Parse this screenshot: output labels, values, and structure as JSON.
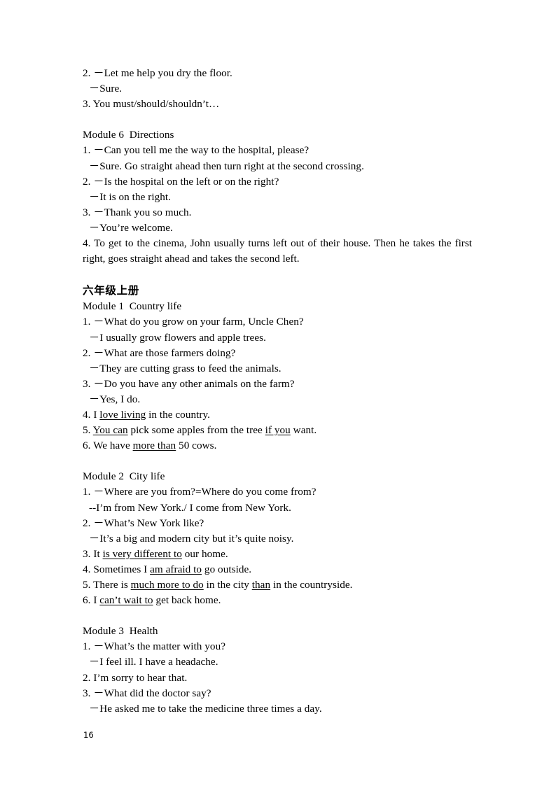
{
  "document": {
    "page_number": "16",
    "blocks": [
      {
        "kind": "line",
        "indent": 0,
        "text": "2. －Let me help you dry the floor."
      },
      {
        "kind": "line",
        "indent": 1,
        "text": "－Sure."
      },
      {
        "kind": "line",
        "indent": 0,
        "text": "3. You must/should/shouldn’t…"
      },
      {
        "kind": "spacer"
      },
      {
        "kind": "heading",
        "indent": 0,
        "text": "Module 6  Directions"
      },
      {
        "kind": "line",
        "indent": 0,
        "text": "1. －Can you tell me the way to the hospital, please?"
      },
      {
        "kind": "line",
        "indent": 1,
        "text": "－Sure. Go straight ahead then turn right at the second crossing."
      },
      {
        "kind": "line",
        "indent": 0,
        "text": "2. －Is the hospital on the left or on the right?"
      },
      {
        "kind": "line",
        "indent": 1,
        "text": "－It is on the right."
      },
      {
        "kind": "line",
        "indent": 0,
        "text": "3. －Thank you so much."
      },
      {
        "kind": "line",
        "indent": 1,
        "text": "－You’re welcome."
      },
      {
        "kind": "para",
        "indent": 0,
        "text": "4. To get to the cinema, John usually turns left out of their house. Then he takes the first right, goes straight ahead and takes the second left."
      },
      {
        "kind": "spacer"
      },
      {
        "kind": "cn-heading",
        "indent": 0,
        "text": "六年级上册"
      },
      {
        "kind": "heading",
        "indent": 0,
        "text": "Module 1  Country life"
      },
      {
        "kind": "line",
        "indent": 0,
        "text": "1. －What do you grow on your farm, Uncle Chen?"
      },
      {
        "kind": "line",
        "indent": 1,
        "text": "－I usually grow flowers and apple trees."
      },
      {
        "kind": "line",
        "indent": 0,
        "text": "2. －What are those farmers doing?"
      },
      {
        "kind": "line",
        "indent": 1,
        "text": "－They are cutting grass to feed the animals."
      },
      {
        "kind": "line",
        "indent": 0,
        "text": "3. －Do you have any other animals on the farm?"
      },
      {
        "kind": "line",
        "indent": 1,
        "text": "－Yes, I do."
      },
      {
        "kind": "rich",
        "indent": 0,
        "parts": [
          {
            "t": "4. I "
          },
          {
            "t": "love living",
            "u": true
          },
          {
            "t": " in the country."
          }
        ]
      },
      {
        "kind": "rich",
        "indent": 0,
        "parts": [
          {
            "t": "5. "
          },
          {
            "t": "You can",
            "u": true
          },
          {
            "t": " pick some apples from the tree "
          },
          {
            "t": "if you",
            "u": true
          },
          {
            "t": " want."
          }
        ]
      },
      {
        "kind": "rich",
        "indent": 0,
        "parts": [
          {
            "t": "6. We have "
          },
          {
            "t": "more than",
            "u": true
          },
          {
            "t": " 50 cows."
          }
        ]
      },
      {
        "kind": "spacer"
      },
      {
        "kind": "heading",
        "indent": 0,
        "text": "Module 2  City life"
      },
      {
        "kind": "line",
        "indent": 0,
        "text": "1. －Where are you from?=Where do you come from?"
      },
      {
        "kind": "line",
        "indent": 1,
        "text": "--I’m from New York./ I come from New York."
      },
      {
        "kind": "line",
        "indent": 0,
        "text": "2. －What’s New York like?"
      },
      {
        "kind": "line",
        "indent": 1,
        "text": "－It’s a big and modern city but it’s quite noisy."
      },
      {
        "kind": "rich",
        "indent": 0,
        "parts": [
          {
            "t": "3. It "
          },
          {
            "t": "is very different to",
            "u": true
          },
          {
            "t": " our home."
          }
        ]
      },
      {
        "kind": "rich",
        "indent": 0,
        "parts": [
          {
            "t": "4. Sometimes I "
          },
          {
            "t": "am afraid to",
            "u": true
          },
          {
            "t": " go outside."
          }
        ]
      },
      {
        "kind": "rich",
        "indent": 0,
        "parts": [
          {
            "t": "5. There is "
          },
          {
            "t": "much more to do",
            "u": true
          },
          {
            "t": " in the city "
          },
          {
            "t": "than",
            "u": true
          },
          {
            "t": " in the countryside."
          }
        ]
      },
      {
        "kind": "rich",
        "indent": 0,
        "parts": [
          {
            "t": "6. I "
          },
          {
            "t": "can’t wait to",
            "u": true
          },
          {
            "t": " get back home."
          }
        ]
      },
      {
        "kind": "spacer"
      },
      {
        "kind": "heading",
        "indent": 0,
        "text": "Module 3  Health"
      },
      {
        "kind": "line",
        "indent": 0,
        "text": "1. －What’s the matter with you?"
      },
      {
        "kind": "line",
        "indent": 1,
        "text": "－I feel ill. I have a headache."
      },
      {
        "kind": "line",
        "indent": 0,
        "text": "2. I’m sorry to hear that."
      },
      {
        "kind": "line",
        "indent": 0,
        "text": "3. －What did the doctor say?"
      },
      {
        "kind": "line",
        "indent": 1,
        "text": "－He asked me to take the medicine three times a day."
      }
    ]
  }
}
